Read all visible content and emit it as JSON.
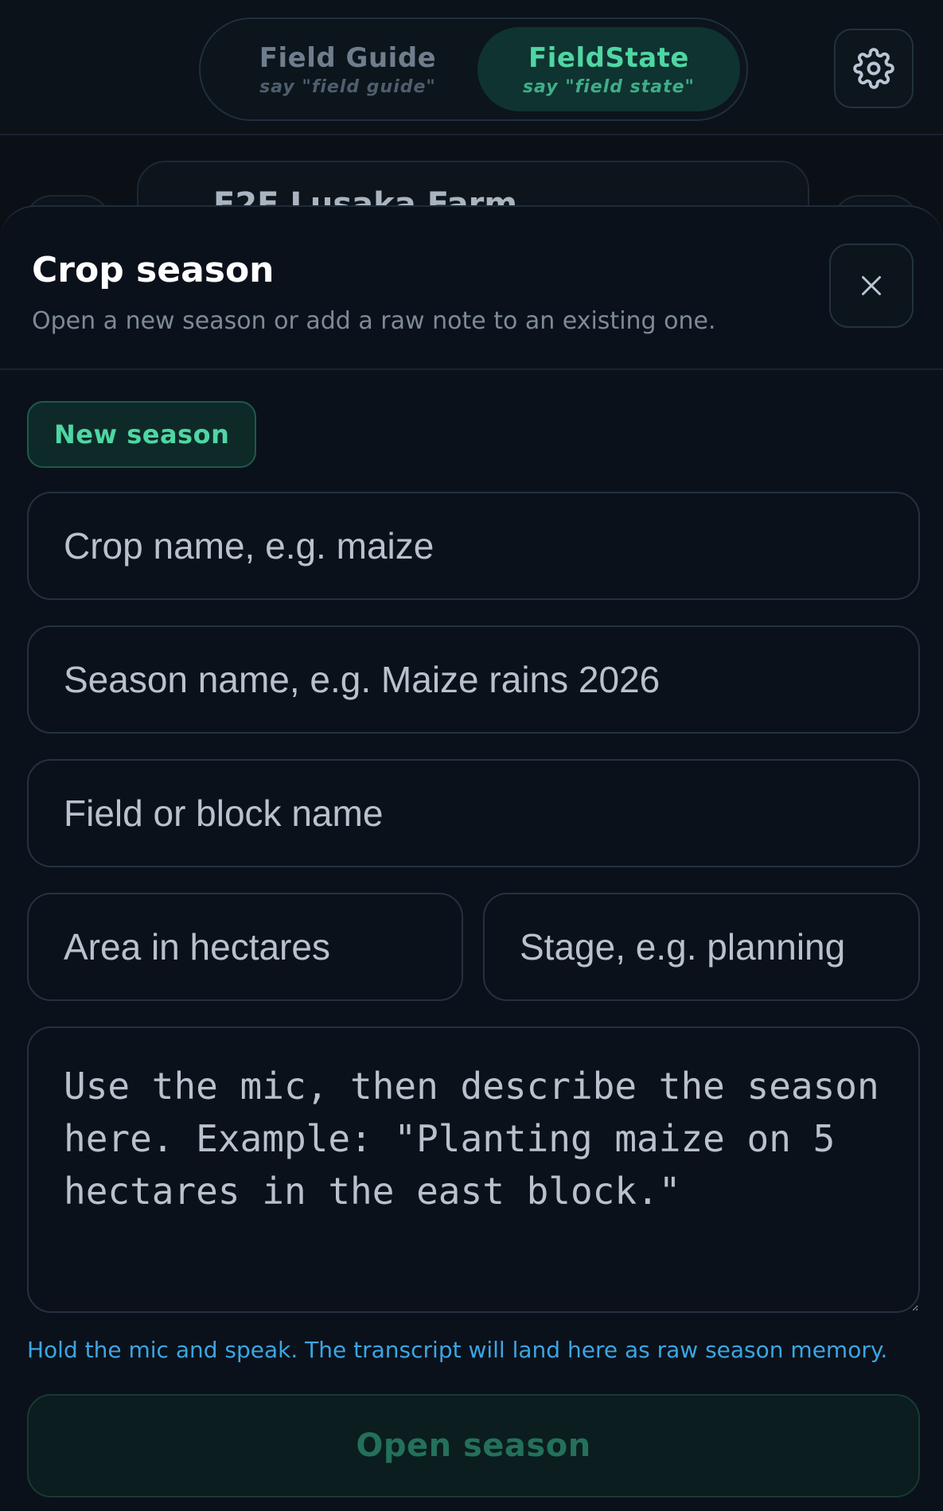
{
  "header": {
    "tabs": [
      {
        "label": "Field Guide",
        "hint": "say \"field guide\""
      },
      {
        "label": "FieldState",
        "hint": "say \"field state\""
      }
    ],
    "settings_icon": "gear-icon"
  },
  "background": {
    "card_title": "F2F Lusaka Farm"
  },
  "sheet": {
    "title": "Crop season",
    "subtitle": "Open a new season or add a raw note to an existing one.",
    "close_icon": "close-icon",
    "chip_label": "New season",
    "fields": {
      "crop_placeholder": "Crop name, e.g. maize",
      "season_placeholder": "Season name, e.g. Maize rains 2026",
      "block_placeholder": "Field or block name",
      "area_placeholder": "Area in hectares",
      "stage_placeholder": "Stage, e.g. planning",
      "notes_placeholder": "Use the mic, then describe the season here. Example: \"Planting maize on 5 hectares in the east block.\""
    },
    "hint": "Hold the mic and speak. The transcript will land here as raw season memory.",
    "submit_label": "Open season"
  },
  "colors": {
    "accent": "#4fd6a3",
    "hint": "#3aa6e3",
    "background": "#0b1017"
  }
}
